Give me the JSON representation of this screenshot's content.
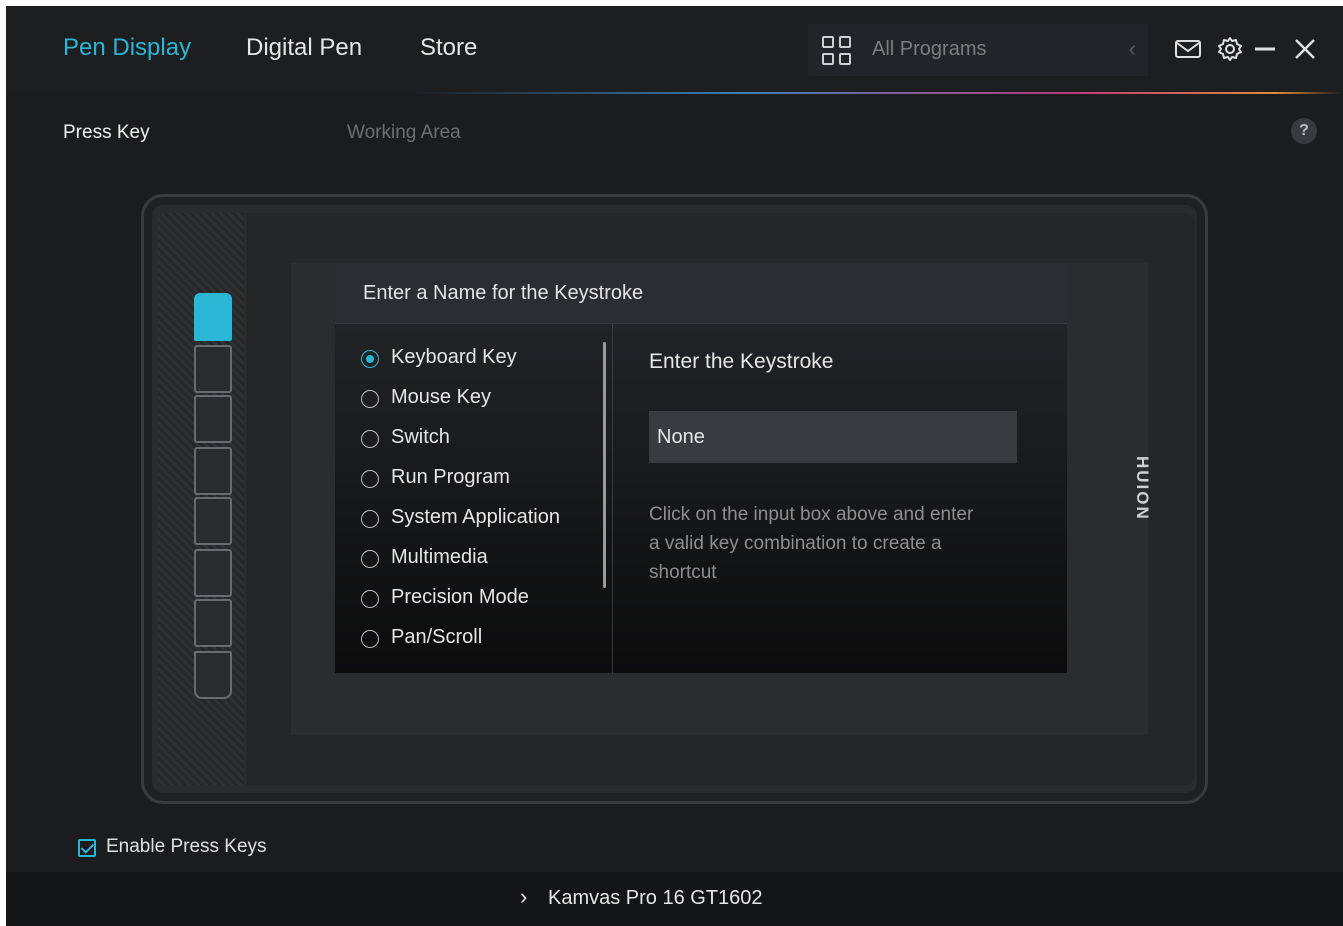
{
  "header": {
    "tabs": [
      {
        "label": "Pen Display",
        "active": true
      },
      {
        "label": "Digital Pen",
        "active": false
      },
      {
        "label": "Store",
        "active": false
      }
    ],
    "programs": {
      "label": "All Programs",
      "icon": "grid-icon",
      "arrow_icon": "chevron-left-icon"
    },
    "window_icons": [
      "mail-icon",
      "gear-icon",
      "minimize-icon",
      "close-icon"
    ]
  },
  "subtabs": [
    {
      "label": "Press Key",
      "active": true
    },
    {
      "label": "Working Area",
      "active": false
    }
  ],
  "help_label": "?",
  "tablet": {
    "brand": "HUION",
    "press_keys_count": 8,
    "selected_key_index": 0
  },
  "dialog": {
    "title": "Enter a Name for the Keystroke",
    "options": [
      {
        "label": "Keyboard Key",
        "selected": true
      },
      {
        "label": "Mouse Key",
        "selected": false
      },
      {
        "label": "Switch",
        "selected": false
      },
      {
        "label": "Run Program",
        "selected": false
      },
      {
        "label": "System Application",
        "selected": false
      },
      {
        "label": "Multimedia",
        "selected": false
      },
      {
        "label": "Precision Mode",
        "selected": false
      },
      {
        "label": "Pan/Scroll",
        "selected": false
      }
    ],
    "keystroke_title": "Enter the Keystroke",
    "keystroke_value": "None",
    "keystroke_hint": "Click on the input box above and enter a valid key combination to create a shortcut"
  },
  "enable_press_keys": {
    "label": "Enable Press Keys",
    "checked": true
  },
  "footer": {
    "device_label": "Kamvas Pro 16 GT1602"
  },
  "colors": {
    "accent": "#2ab7d6",
    "background": "#1b1c1e"
  }
}
